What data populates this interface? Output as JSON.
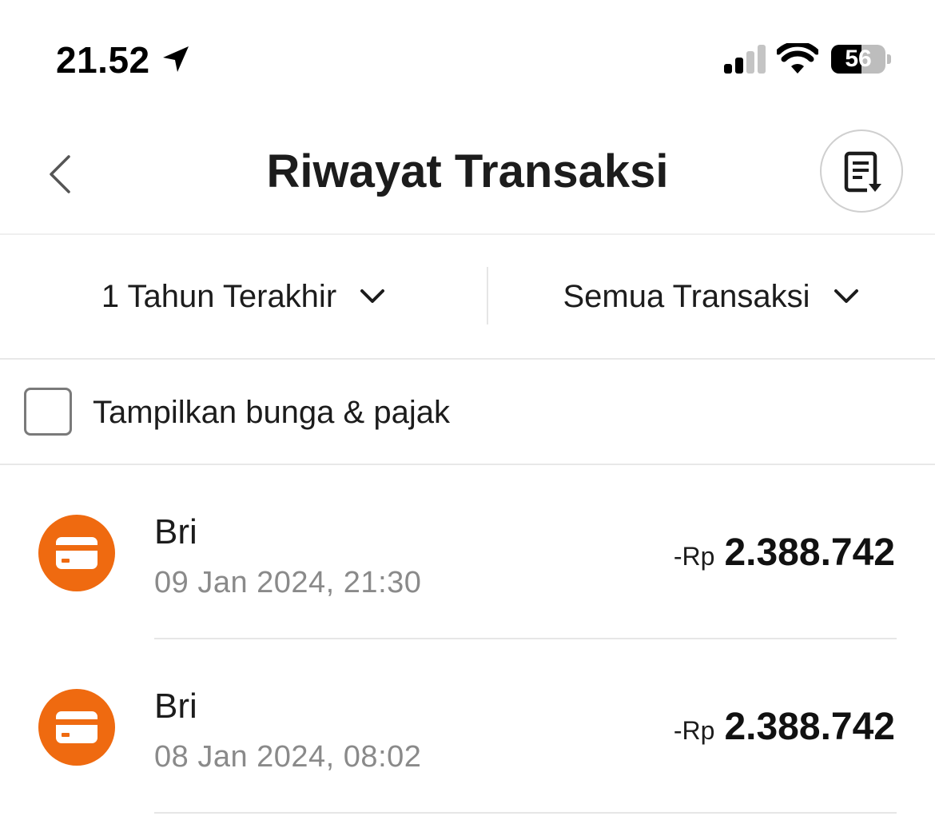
{
  "status_bar": {
    "time": "21.52",
    "battery": "56",
    "battery_level": 0.56,
    "icons": [
      "location-arrow-icon",
      "cellular-signal-icon",
      "wifi-icon",
      "battery-icon"
    ]
  },
  "header": {
    "title": "Riwayat Transaksi",
    "back_icon": "chevron-left-icon",
    "download_icon": "document-download-icon"
  },
  "filters": {
    "period": "1 Tahun Terakhir",
    "type": "Semua Transaksi",
    "chevron_icon": "chevron-down-icon"
  },
  "options": {
    "show_interest_tax_label": "Tampilkan bunga & pajak",
    "show_interest_tax_checked": false
  },
  "transactions": [
    {
      "name": "Bri",
      "datetime": "09 Jan 2024, 21:30",
      "amount_prefix": "-Rp",
      "amount": "2.388.742",
      "icon": "card-icon"
    },
    {
      "name": "Bri",
      "datetime": "08 Jan 2024, 08:02",
      "amount_prefix": "-Rp",
      "amount": "2.388.742",
      "icon": "card-icon"
    }
  ],
  "colors": {
    "accent": "#ef6a10",
    "text_primary": "#1c1c1c",
    "text_secondary": "#8a8a8a",
    "divider": "#e6e6e6"
  }
}
